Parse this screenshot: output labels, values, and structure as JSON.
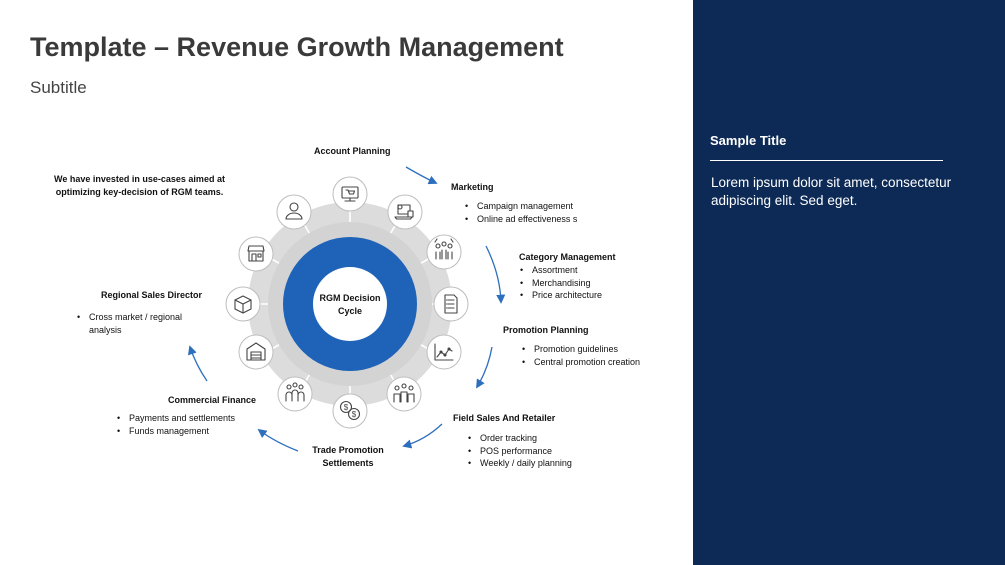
{
  "slide": {
    "title": "Template – Revenue Growth Management",
    "subtitle": "Subtitle"
  },
  "panel": {
    "title": "Sample Title",
    "body": "Lorem ipsum dolor sit amet, consectetur adipiscing elit. Sed eget."
  },
  "intro_note": "We have invested in use-cases aimed at optimizing key-decision of RGM teams.",
  "center": {
    "line1": "RGM Decision",
    "line2": "Cycle"
  },
  "colors": {
    "panel_bg": "#0c2a55",
    "ring_blue": "#1f63b8",
    "ring_grey": "#dcdcdc",
    "arrow_blue": "#2e6fbd"
  },
  "stages": {
    "account_planning": {
      "title": "Account Planning"
    },
    "marketing": {
      "title": "Marketing",
      "bullets": [
        "Campaign management",
        "Online ad effectiveness s"
      ]
    },
    "category_management": {
      "title": "Category Management",
      "bullets": [
        "Assortment",
        "Merchandising",
        "Price architecture"
      ]
    },
    "promotion_planning": {
      "title": "Promotion Planning",
      "bullets": [
        "Promotion guidelines",
        "Central promotion creation"
      ]
    },
    "field_sales": {
      "title": "Field Sales And Retailer",
      "bullets": [
        "Order tracking",
        "POS performance",
        "Weekly / daily planning"
      ]
    },
    "trade_promotion": {
      "title_line1": "Trade Promotion",
      "title_line2": "Settlements"
    },
    "commercial_finance": {
      "title": "Commercial Finance",
      "bullets": [
        "Payments and settlements",
        "Funds management"
      ]
    },
    "regional_sales": {
      "title": "Regional Sales Director",
      "bullets": [
        "Cross market / regional",
        "analysis"
      ]
    }
  },
  "icons": [
    "monitor-icon",
    "laptop-icon",
    "group-icon",
    "checklist-icon",
    "chart-icon",
    "team-icon",
    "dollar-coins-icon",
    "people-icon",
    "warehouse-icon",
    "box-icon",
    "store-icon",
    "person-icon"
  ]
}
